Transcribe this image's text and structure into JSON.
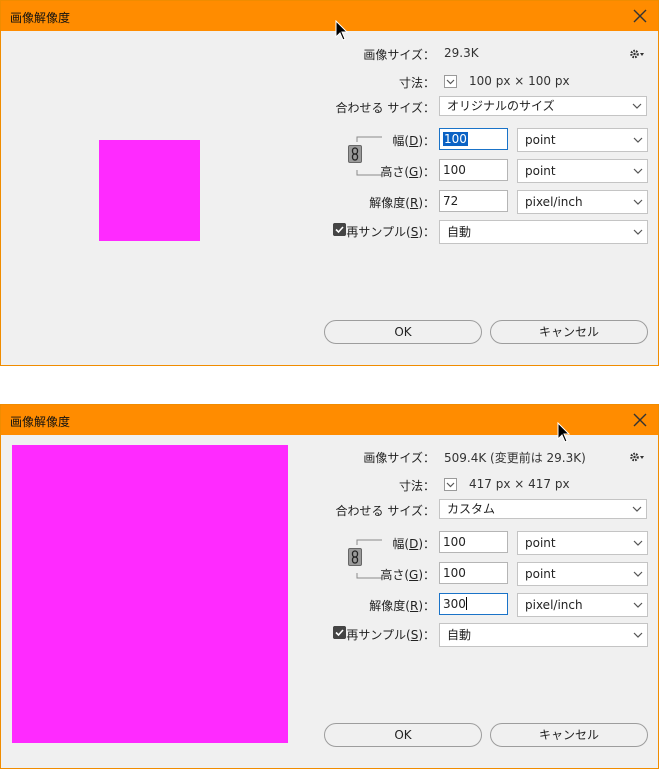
{
  "dialog_before": {
    "title": "画像解像度",
    "image_size_label": "画像サイズ：",
    "image_size_value": "29.3K",
    "dimensions_label": "寸法：",
    "dimensions_value": "100 px × 100 px",
    "fit_label": "合わせる サイズ：",
    "fit_value": "オリジナルのサイズ",
    "width_label": "幅(",
    "width_key": "D",
    "width_value": "100",
    "width_unit": "point",
    "height_label": "高さ(",
    "height_key": "G",
    "height_value": "100",
    "height_unit": "point",
    "resolution_label": "解像度(",
    "resolution_key": "R",
    "resolution_value": "72",
    "resolution_unit": "pixel/inch",
    "resample_label": "再サンプル(",
    "resample_key": "S",
    "resample_value": "自動",
    "resample_checked": true,
    "ok_label": "OK",
    "cancel_label": "キャンセル",
    "preview_color": "#ff2aff"
  },
  "dialog_after": {
    "title": "画像解像度",
    "image_size_label": "画像サイズ：",
    "image_size_value": "509.4K (変更前は 29.3K)",
    "dimensions_label": "寸法：",
    "dimensions_value": "417 px × 417 px",
    "fit_label": "合わせる サイズ：",
    "fit_value": "カスタム",
    "width_label": "幅(",
    "width_key": "D",
    "width_value": "100",
    "width_unit": "point",
    "height_label": "高さ(",
    "height_key": "G",
    "height_value": "100",
    "height_unit": "point",
    "resolution_label": "解像度(",
    "resolution_key": "R",
    "resolution_value": "300",
    "resolution_unit": "pixel/inch",
    "resample_label": "再サンプル(",
    "resample_key": "S",
    "resample_value": "自動",
    "resample_checked": true,
    "ok_label": "OK",
    "cancel_label": "キャンセル",
    "preview_color": "#ff2aff"
  },
  "colors": {
    "titlebar": "#ff8c00",
    "border": "#f08c00",
    "panel": "#f0f0f0",
    "focus": "#1a73c8"
  }
}
